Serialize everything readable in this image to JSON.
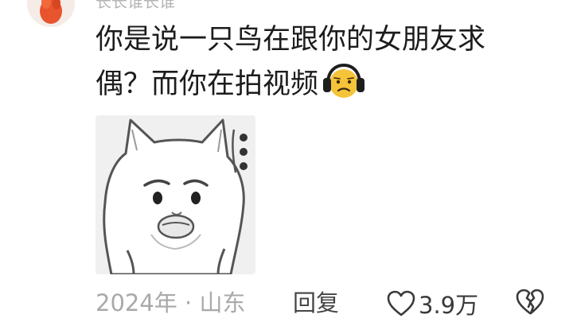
{
  "comment": {
    "username": "长长谁长谁",
    "text_line1": "你是说一只鸟在跟你的女朋友求",
    "text_line2": "偶？而你在拍视频",
    "emoji": "headphones-face-emoji",
    "sticker": "cat-meme-sticker"
  },
  "meta": {
    "date_location": "2024年 · 山东",
    "reply_label": "回复",
    "like_count": "3.9万"
  },
  "icons": {
    "like": "heart-outline-icon",
    "dislike": "broken-heart-icon"
  },
  "colors": {
    "text": "#1c1c1c",
    "meta": "#a9a9a9",
    "avatar_accent": "#e8542e",
    "emoji": "#f5c43a"
  }
}
